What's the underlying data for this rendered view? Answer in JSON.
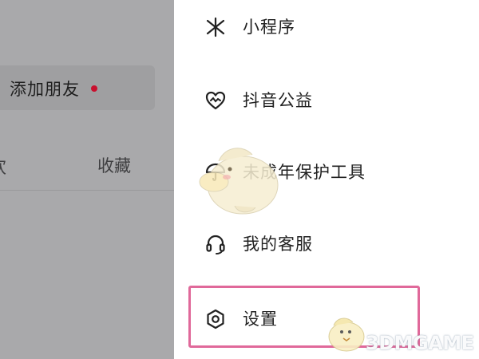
{
  "profile_page": {
    "add_friend_label": "添加朋友",
    "tab_like_partial": "欢",
    "tab_favorites": "收藏"
  },
  "drawer_menu": {
    "items": [
      {
        "label": "小程序",
        "icon": "mini-program-icon"
      },
      {
        "label": "抖音公益",
        "icon": "charity-heart-icon"
      },
      {
        "label": "未成年保护工具",
        "icon": "umbrella-icon"
      },
      {
        "label": "我的客服",
        "icon": "headset-icon"
      },
      {
        "label": "设置",
        "icon": "settings-hexagon-icon"
      }
    ],
    "highlighted_item": "设置"
  },
  "watermark": {
    "text": "3DMGAME"
  },
  "colors": {
    "overlay_gray": "#a9a9ab",
    "notification_dot": "#c8102e",
    "highlight_border": "#e0699a",
    "text_dark": "#222222"
  }
}
